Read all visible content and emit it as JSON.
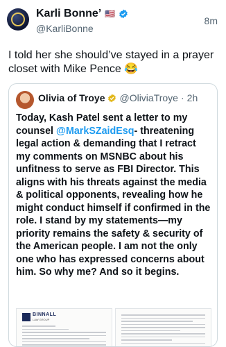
{
  "post": {
    "display_name": "Karli Bonne’",
    "flag_emoji": "🇺🇸",
    "handle": "@KarliBonne",
    "time": "8m",
    "text": "I told her she should’ve stayed in a prayer closet with Mike Pence 😂"
  },
  "quote": {
    "display_name": "Olivia of Troye",
    "handle": "@OliviaTroye",
    "separator": "·",
    "time": "2h",
    "text_before": "Today, Kash Patel sent a letter to my counsel ",
    "mention": "@MarkSZaidEsq",
    "text_after": "- threatening legal action & demanding that I retract my comments on MSNBC about his unfitness to serve as FBI Director. This aligns with his threats against the media & political opponents, revealing how he might conduct himself if confirmed in the role. I stand by my statements—my priority remains the safety & security of the American people. I am not the only one who has expressed concerns about him. So why me? And so it begins.",
    "image_firm": "BINNALL",
    "image_subfirm": "LAW GROUP"
  },
  "colors": {
    "verified": "#1d9bf0",
    "mention": "#1d9bf0",
    "muted": "#536471"
  },
  "icons": [
    "verified-badge-icon",
    "gold-verified-badge-icon"
  ]
}
